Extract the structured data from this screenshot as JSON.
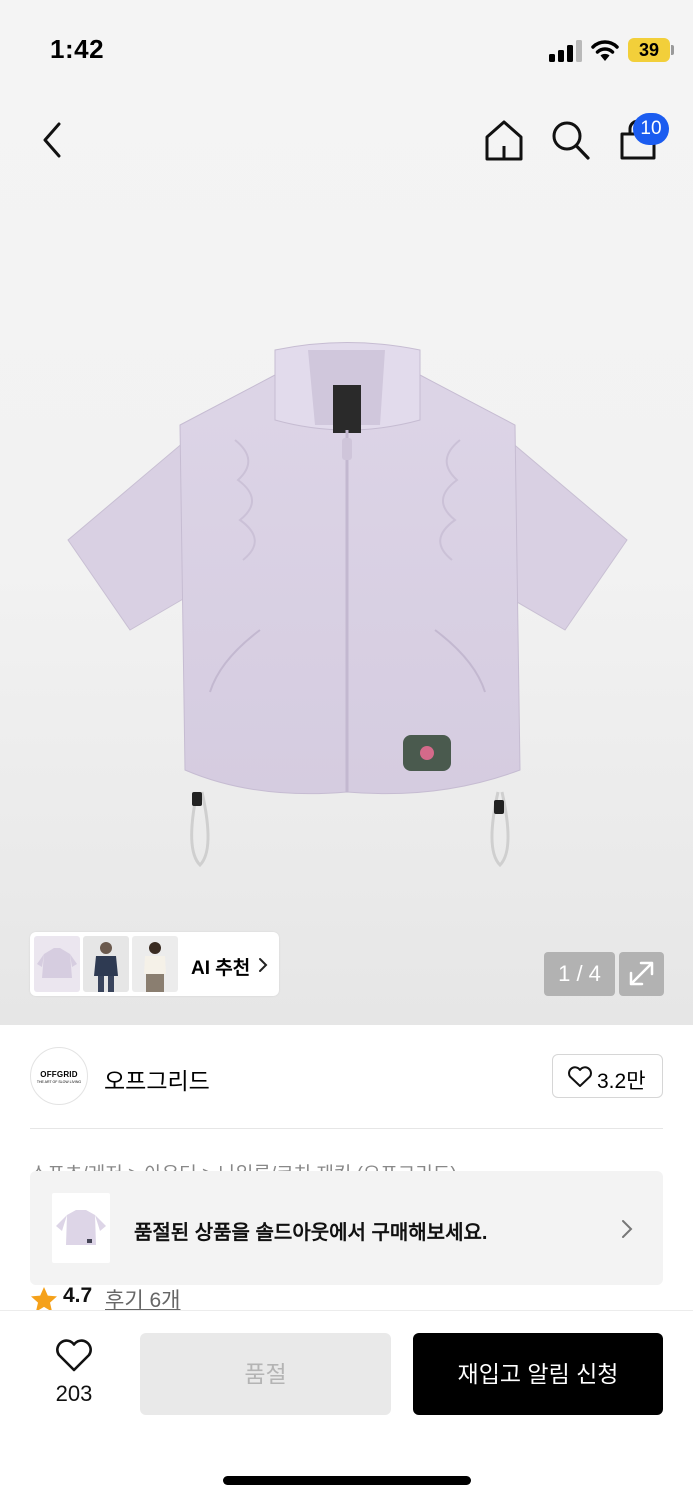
{
  "status_bar": {
    "time": "1:42",
    "battery": "39"
  },
  "nav": {
    "cart_count": "10"
  },
  "gallery": {
    "ai_label": "AI 추천",
    "pager": "1 / 4"
  },
  "brand": {
    "logo_text": "OFFGRID",
    "logo_sub": "THE ART OF SLOW LIVING",
    "name": "오프그리드",
    "likes": "3.2만"
  },
  "breadcrumb": "스포츠/레저 > 아우터 > 나일론/코치 재킷 (오프그리드)",
  "banner": {
    "text": "품절된 상품을 솔드아웃에서 구매해보세요."
  },
  "rating": {
    "score": "4.7",
    "reviews": "후기 6개"
  },
  "bottom_bar": {
    "wish_count": "203",
    "soldout_label": "품절",
    "restock_label": "재입고 알림 신청"
  },
  "colors": {
    "accent": "#1b5cf0",
    "star": "#f5a11a",
    "battery": "#f2cf3a",
    "product": "#ddd5e6"
  },
  "icons": [
    "back-icon",
    "home-icon",
    "search-icon",
    "shopping-bag-icon",
    "chevron-right-icon",
    "expand-icon",
    "heart-icon",
    "star-icon"
  ]
}
